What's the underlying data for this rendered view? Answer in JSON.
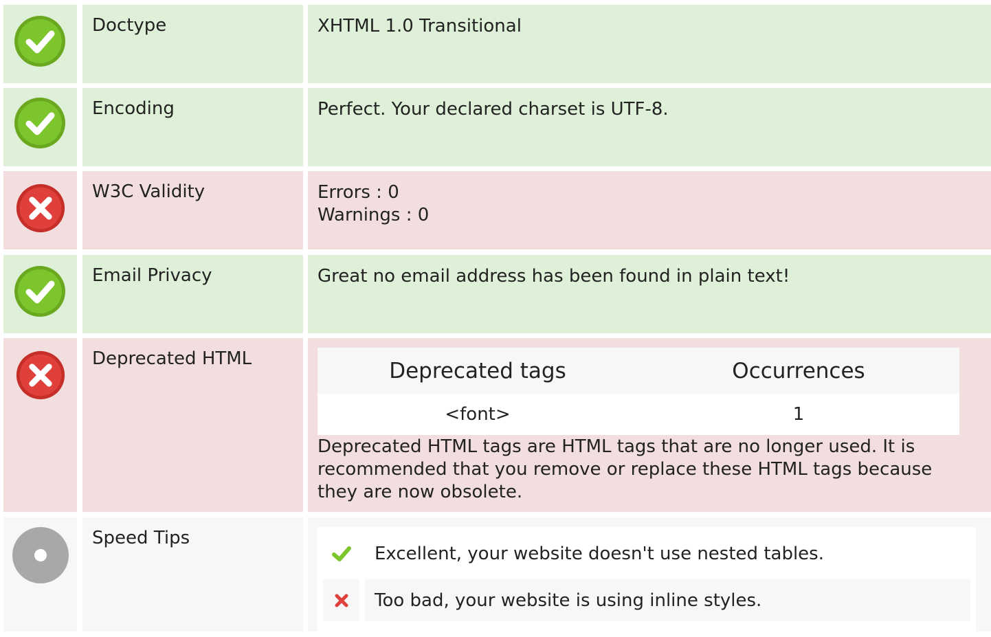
{
  "colors": {
    "pass_bg": "#dff0d8",
    "fail_bg": "#f2dede",
    "neutral_bg": "#f7f7f7",
    "pass_icon": "#7cc52c",
    "fail_icon": "#e0403c",
    "neutral_icon": "#a8a8ab"
  },
  "rows": {
    "doctype": {
      "label": "Doctype",
      "value": "XHTML 1.0 Transitional",
      "status": "pass"
    },
    "encoding": {
      "label": "Encoding",
      "value": "Perfect. Your declared charset is UTF-8.",
      "status": "pass"
    },
    "w3c": {
      "label": "W3C Validity",
      "errors": "Errors : 0",
      "warnings": "Warnings : 0",
      "status": "fail"
    },
    "email": {
      "label": "Email Privacy",
      "value": "Great no email address has been found in plain text!",
      "status": "pass"
    },
    "deprecated": {
      "label": "Deprecated HTML",
      "status": "fail",
      "table_headers": [
        "Deprecated tags",
        "Occurrences"
      ],
      "table_rows": [
        [
          "<font>",
          "1"
        ]
      ],
      "note": "Deprecated HTML tags are HTML tags that are no longer used. It is recommended that you remove or replace these HTML tags because they are now obsolete."
    },
    "speed": {
      "label": "Speed Tips",
      "status": "neutral",
      "tips": [
        {
          "status": "pass",
          "icon": "check-icon",
          "text": "Excellent, your website doesn't use nested tables."
        },
        {
          "status": "fail",
          "icon": "cross-icon",
          "text": "Too bad, your website is using inline styles."
        }
      ]
    }
  }
}
